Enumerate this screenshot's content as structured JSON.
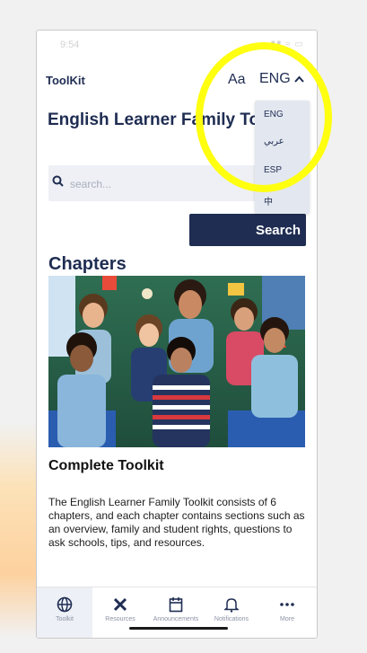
{
  "status_bar": {
    "time": "9:54",
    "icons": "▮▮ ≈ ▭"
  },
  "header": {
    "brand": "ToolKit",
    "font_size_label": "Aa",
    "language_code": "ENG",
    "chevron": "^"
  },
  "language_menu": {
    "options": [
      "ENG",
      "عربي",
      "ESP",
      "中"
    ]
  },
  "hero": {
    "title": "English Learner Family Toolkit",
    "search": {
      "placeholder": "search..."
    },
    "search_button": "Search"
  },
  "chapters": {
    "heading": "Chapters",
    "card_title": "Complete Toolkit",
    "card_description": "The English Learner Family Toolkit consists of 6 chapters, and each chapter contains sections such as an overview, family and student rights, questions to ask schools, tips, and resources."
  },
  "tab_bar": {
    "tabs": [
      {
        "label": "Toolkit",
        "icon": "globe-icon"
      },
      {
        "label": "Resources",
        "icon": "tools-icon"
      },
      {
        "label": "Announcements",
        "icon": "calendar-icon"
      },
      {
        "label": "Notifications",
        "icon": "bell-icon"
      },
      {
        "label": "More",
        "icon": "more-icon"
      }
    ]
  },
  "colors": {
    "brand_navy": "#1f2d52",
    "highlight_yellow": "#ffff10",
    "menu_background": "#e3e7ef"
  }
}
